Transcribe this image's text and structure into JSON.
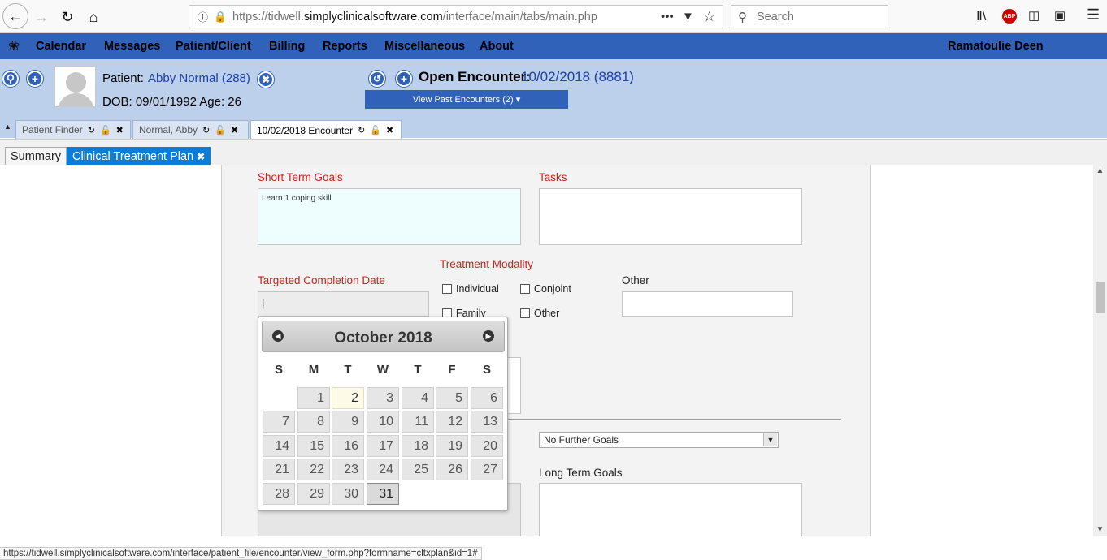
{
  "browser": {
    "url_prefix": "https://tidwell.",
    "url_domain": "simplyclinicalsoftware.com",
    "url_path": "/interface/main/tabs/main.php",
    "search_placeholder": "Search",
    "status_url": "https://tidwell.simplyclinicalsoftware.com/interface/patient_file/encounter/view_form.php?formname=cltxplan&id=1#"
  },
  "menu": {
    "items": [
      "Calendar",
      "Messages",
      "Patient/Client",
      "Billing",
      "Reports",
      "Miscellaneous",
      "About"
    ],
    "user": "Ramatoulie Deen"
  },
  "patient": {
    "label": "Patient:",
    "name": "Abby Normal (288)",
    "dob": "DOB: 09/01/1992 Age: 26"
  },
  "encounter": {
    "label": "Open Encounter:",
    "value": "10/02/2018 (8881)",
    "past_button": "View Past Encounters  (2) ▾"
  },
  "tabs": [
    "Patient Finder",
    "Normal, Abby",
    "10/02/2018 Encounter"
  ],
  "subtabs": {
    "summary": "Summary",
    "plan": "Clinical Treatment Plan"
  },
  "form": {
    "short_term_goals_label": "Short Term Goals",
    "short_term_goals_value": "Learn 1 coping skill",
    "tasks_label": "Tasks",
    "treatment_modality_label": "Treatment Modality",
    "targeted_completion_label": "Targeted Completion Date",
    "other_label": "Other",
    "modalities": [
      "Individual",
      "Conjoint",
      "Family",
      "Other"
    ],
    "further_goals_value": "No Further Goals",
    "long_term_goals_label": "Long Term Goals"
  },
  "calendar": {
    "month_title": "October 2018",
    "dow": [
      "S",
      "M",
      "T",
      "W",
      "T",
      "F",
      "S"
    ],
    "days": [
      "1",
      "2",
      "3",
      "4",
      "5",
      "6",
      "7",
      "8",
      "9",
      "10",
      "11",
      "12",
      "13",
      "14",
      "15",
      "16",
      "17",
      "18",
      "19",
      "20",
      "21",
      "22",
      "23",
      "24",
      "25",
      "26",
      "27",
      "28",
      "29",
      "30",
      "31"
    ],
    "today": "2",
    "hovered": "31"
  }
}
